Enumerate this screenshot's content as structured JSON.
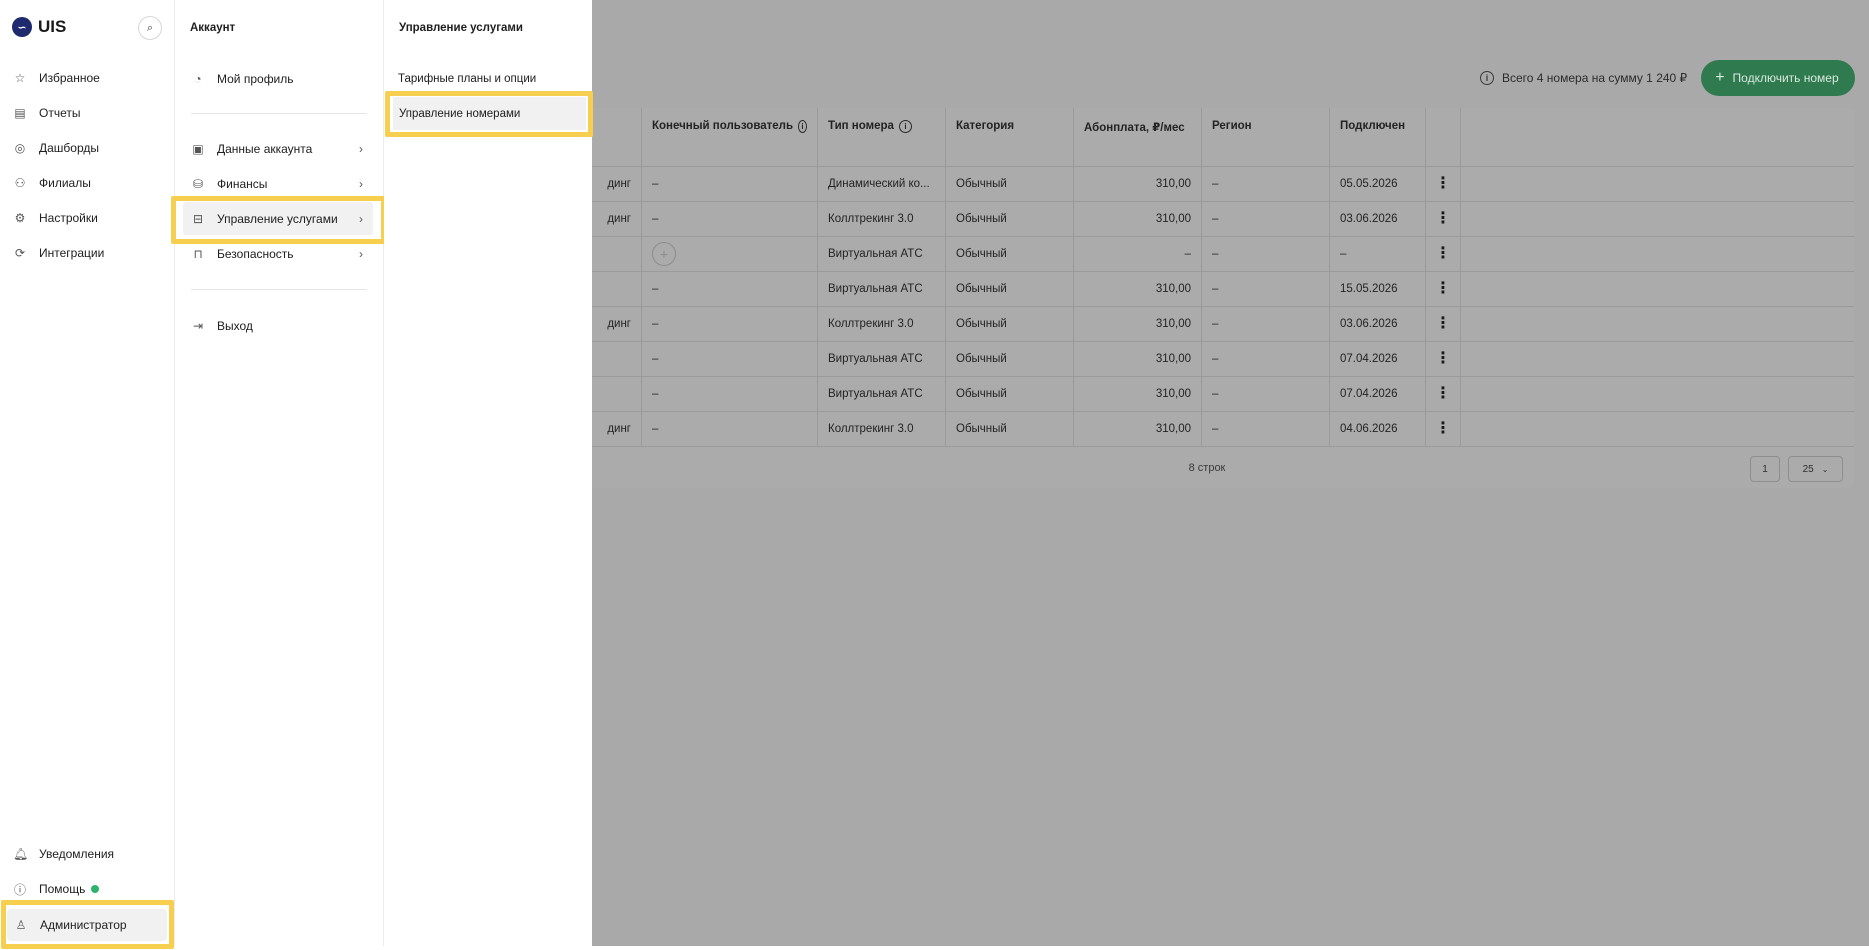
{
  "app": {
    "brand": "UIS"
  },
  "sidebar": {
    "items": [
      {
        "label": "Избранное",
        "icon": "star-icon"
      },
      {
        "label": "Отчеты",
        "icon": "reports-icon"
      },
      {
        "label": "Дашборды",
        "icon": "dashboard-icon"
      },
      {
        "label": "Филиалы",
        "icon": "branches-icon"
      },
      {
        "label": "Настройки",
        "icon": "gear-icon"
      },
      {
        "label": "Интеграции",
        "icon": "integrations-icon"
      }
    ],
    "bottom": [
      {
        "label": "Уведомления",
        "icon": "bell-icon"
      },
      {
        "label": "Помощь",
        "icon": "help-icon"
      },
      {
        "label": "Администратор",
        "icon": "user-icon"
      }
    ]
  },
  "account_panel": {
    "title": "Аккаунт",
    "items": [
      {
        "label": "Мой профиль",
        "icon": "profile-icon"
      },
      {
        "label": "Данные аккаунта",
        "icon": "id-card-icon"
      },
      {
        "label": "Финансы",
        "icon": "coins-icon"
      },
      {
        "label": "Управление услугами",
        "icon": "briefcase-icon"
      },
      {
        "label": "Безопасность",
        "icon": "lock-icon"
      },
      {
        "label": "Выход",
        "icon": "logout-icon"
      }
    ]
  },
  "services_panel": {
    "title": "Управление услугами",
    "items": [
      {
        "label": "Тарифные планы и опции"
      },
      {
        "label": "Управление номерами"
      }
    ]
  },
  "toolbar": {
    "summary": "Всего 4 номера на сумму 1 240 ₽",
    "connect_label": "Подключить номер"
  },
  "table": {
    "columns": [
      "Конечный пользователь",
      "Тип номера",
      "Категория",
      "Абонплата, ₽/мес",
      "Регион",
      "Подключен"
    ],
    "rows": [
      {
        "prefix": "динг",
        "user": "–",
        "type": "Динамический ко...",
        "category": "Обычный",
        "fee": "310,00",
        "region": "–",
        "connected": "05.05.2026"
      },
      {
        "prefix": "динг",
        "user": "–",
        "type": "Коллтрекинг 3.0",
        "category": "Обычный",
        "fee": "310,00",
        "region": "–",
        "connected": "03.06.2026"
      },
      {
        "prefix": "",
        "user": "+",
        "type": "Виртуальная АТС",
        "category": "Обычный",
        "fee": "–",
        "region": "–",
        "connected": "–"
      },
      {
        "prefix": "",
        "user": "–",
        "type": "Виртуальная АТС",
        "category": "Обычный",
        "fee": "310,00",
        "region": "–",
        "connected": "15.05.2026"
      },
      {
        "prefix": "динг",
        "user": "–",
        "type": "Коллтрекинг 3.0",
        "category": "Обычный",
        "fee": "310,00",
        "region": "–",
        "connected": "03.06.2026"
      },
      {
        "prefix": "",
        "user": "–",
        "type": "Виртуальная АТС",
        "category": "Обычный",
        "fee": "310,00",
        "region": "–",
        "connected": "07.04.2026"
      },
      {
        "prefix": "",
        "user": "–",
        "type": "Виртуальная АТС",
        "category": "Обычный",
        "fee": "310,00",
        "region": "–",
        "connected": "07.04.2026"
      },
      {
        "prefix": "динг",
        "user": "–",
        "type": "Коллтрекинг 3.0",
        "category": "Обычный",
        "fee": "310,00",
        "region": "–",
        "connected": "04.06.2026"
      }
    ],
    "footer": "8 строк",
    "page": "1",
    "page_size": "25"
  }
}
